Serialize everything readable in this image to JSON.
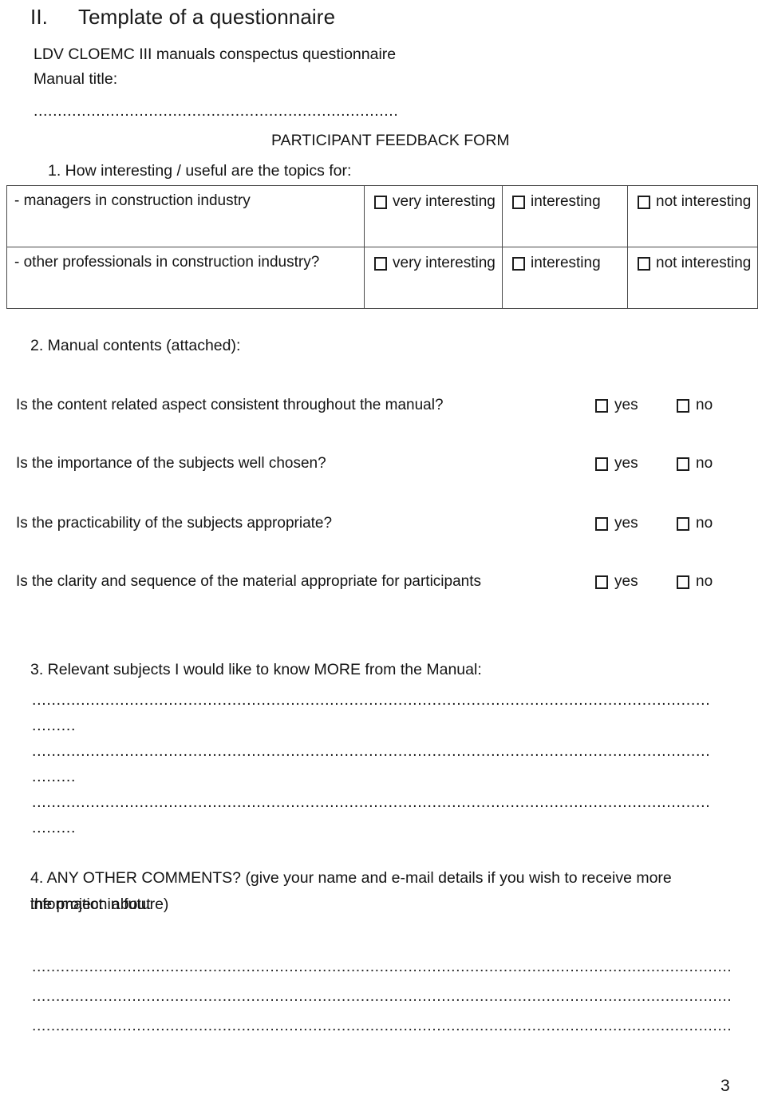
{
  "document": {
    "heading": {
      "numeral": "II.",
      "title": "Template of a questionnaire"
    },
    "intro": {
      "lead": "LDV CLOEMC III manuals conspectus questionnaire",
      "manual_title_label": "Manual title:",
      "manual_title_value": "............................................................................",
      "form_title": "PARTICIPANT FEEDBACK FORM"
    },
    "section1": {
      "heading": "1. How interesting / useful are the topics for:",
      "columns": [
        "",
        "very interesting",
        "interesting",
        "not interesting"
      ],
      "rows": [
        {
          "label": "- managers in construction industry",
          "options": [
            "very interesting",
            "interesting",
            "not interesting"
          ]
        },
        {
          "label": "- other professionals in construction industry?",
          "options": [
            "very interesting",
            "interesting",
            "not interesting"
          ]
        }
      ]
    },
    "section2": {
      "heading": "2. Manual contents (attached):",
      "yes_label": "yes",
      "no_label": "no",
      "questions": [
        "Is the content related aspect consistent throughout the manual?",
        "Is the importance of the subjects well chosen?",
        "Is the practicability of the subjects appropriate?",
        "Is the clarity and sequence of the material appropriate for participants"
      ]
    },
    "section3": {
      "heading": "3. Relevant subjects I would like to know MORE from the Manual:",
      "line_long": "...........................................................................................................................................",
      "line_short": "........."
    },
    "section4": {
      "line1": "4. ANY OTHER COMMENTS? (give your name and e-mail details if you wish to receive more information about",
      "line2": "the project in future)",
      "answer_line": "..................................................................................................................................................."
    },
    "footer": {
      "page_number": "3"
    }
  }
}
